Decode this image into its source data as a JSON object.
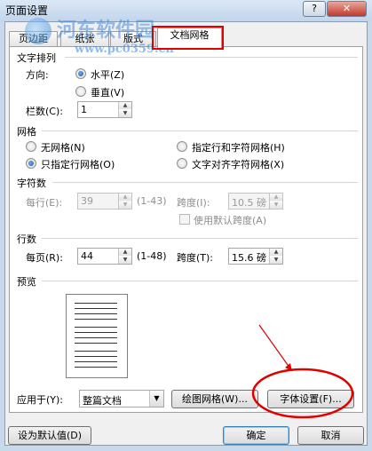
{
  "window": {
    "title": "页面设置",
    "help_glyph": "?",
    "close_glyph": "✕"
  },
  "watermark": {
    "site_name": "河东软件园",
    "url": "www.pc0359.cn"
  },
  "tabs": [
    {
      "label": "页边距"
    },
    {
      "label": "纸张"
    },
    {
      "label": "版式"
    },
    {
      "label": "文档网格"
    }
  ],
  "text_direction": {
    "title": "文字排列",
    "direction_label": "方向:",
    "horizontal_label": "水平(Z)",
    "vertical_label": "垂直(V)",
    "columns_label": "栏数(C):",
    "columns_value": "1"
  },
  "grid": {
    "title": "网格",
    "no_grid": "无网格(N)",
    "line_grid": "只指定行网格(O)",
    "line_char_grid": "指定行和字符网格(H)",
    "text_snap_grid": "文字对齐字符网格(X)"
  },
  "chars": {
    "title": "字符数",
    "per_line_label": "每行(E):",
    "per_line_value": "39",
    "per_line_range": "(1-43)",
    "pitch_label": "跨度(I):",
    "pitch_value": "10.5 磅",
    "default_pitch_label": "使用默认跨度(A)"
  },
  "lines": {
    "title": "行数",
    "per_page_label": "每页(R):",
    "per_page_value": "44",
    "per_page_range": "(1-48)",
    "pitch_label": "跨度(T):",
    "pitch_value": "15.6 磅"
  },
  "preview": {
    "title": "预览"
  },
  "apply": {
    "label": "应用于(Y):",
    "value": "整篇文档"
  },
  "buttons": {
    "draw_grid": "绘图网格(W)...",
    "font_settings": "字体设置(F)...",
    "set_default": "设为默认值(D)",
    "ok": "确定",
    "cancel": "取消"
  },
  "colors": {
    "highlight": "#e00000",
    "titlebar": "#c9d9ec"
  }
}
